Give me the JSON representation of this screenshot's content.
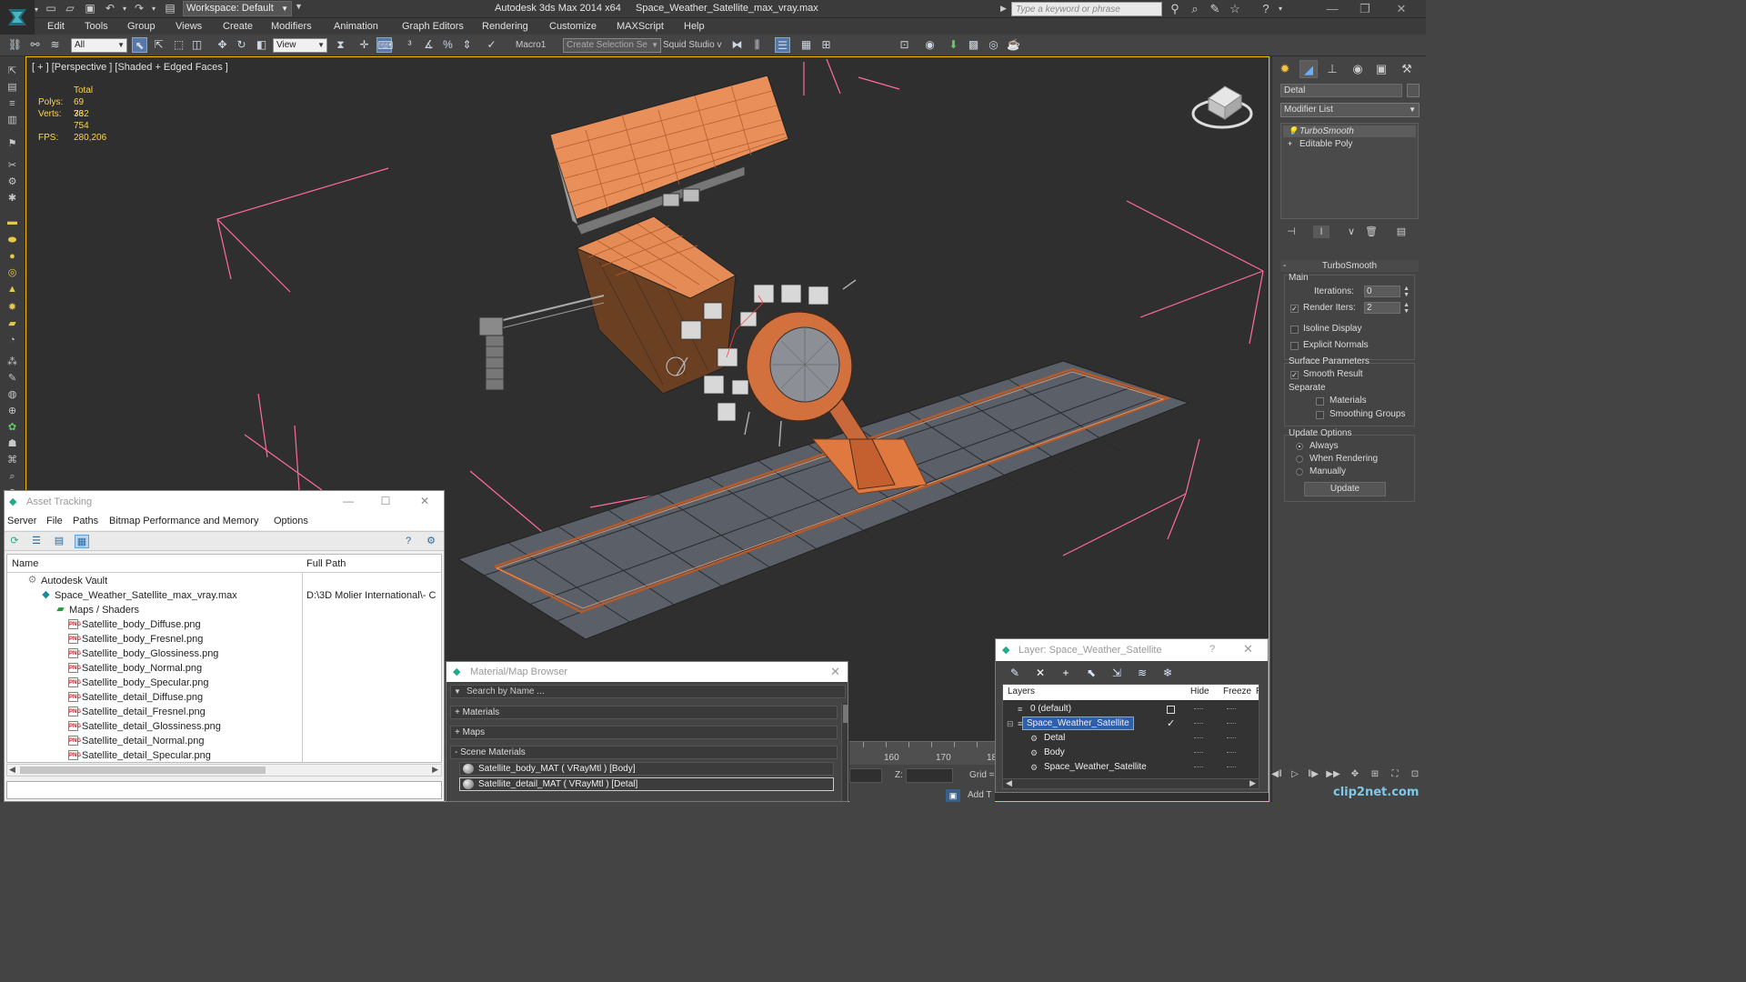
{
  "titlebar": {
    "workspace": "Workspace: Default",
    "app_title": "Autodesk 3ds Max  2014 x64",
    "file_name": "Space_Weather_Satellite_max_vray.max",
    "search_placeholder": "Type a keyword or phrase"
  },
  "menu": [
    "Edit",
    "Tools",
    "Group",
    "Views",
    "Create",
    "Modifiers",
    "Animation",
    "Graph Editors",
    "Rendering",
    "Customize",
    "MAXScript",
    "Help"
  ],
  "toolbar": {
    "selection_filter": "All",
    "ref_coord": "View",
    "macro_label": "Macro1",
    "selection_set": "Create Selection Se",
    "squid": "Squid Studio v"
  },
  "viewport": {
    "label": "[ + ] [Perspective ] [Shaded + Edged Faces ]",
    "stats": {
      "total_label": "Total",
      "polys_label": "Polys:",
      "polys": "69 732",
      "verts_label": "Verts:",
      "verts": "36 754",
      "fps_label": "FPS:",
      "fps": "280,206"
    }
  },
  "command_panel": {
    "object_name": "Detal",
    "modifier_list": "Modifier List",
    "stack": [
      "TurboSmooth",
      "Editable Poly"
    ],
    "rollout_title": "TurboSmooth",
    "main_label": "Main",
    "iterations_label": "Iterations:",
    "iterations": "0",
    "render_iters_label": "Render Iters:",
    "render_iters": "2",
    "render_iters_checked": true,
    "isoline_label": "Isoline Display",
    "explicit_normals_label": "Explicit Normals",
    "surface_params_label": "Surface Parameters",
    "smooth_result_label": "Smooth Result",
    "smooth_result_checked": true,
    "separate_label": "Separate",
    "materials_label": "Materials",
    "smoothing_groups_label": "Smoothing Groups",
    "update_options_label": "Update Options",
    "always_label": "Always",
    "when_rendering_label": "When Rendering",
    "manually_label": "Manually",
    "update_button": "Update"
  },
  "asset_tracking": {
    "title": "Asset Tracking",
    "menu": [
      "Server",
      "File",
      "Paths",
      "Bitmap Performance and Memory",
      "Options"
    ],
    "col_name": "Name",
    "col_path": "Full Path",
    "rows": [
      {
        "name": "Autodesk Vault",
        "path": "",
        "indent": 0,
        "icon": "vault"
      },
      {
        "name": "Space_Weather_Satellite_max_vray.max",
        "path": "D:\\3D Molier International\\- C",
        "indent": 1,
        "icon": "max"
      },
      {
        "name": "Maps / Shaders",
        "path": "",
        "indent": 2,
        "icon": "maps"
      },
      {
        "name": "Satellite_body_Diffuse.png",
        "path": "",
        "indent": 3,
        "icon": "png"
      },
      {
        "name": "Satellite_body_Fresnel.png",
        "path": "",
        "indent": 3,
        "icon": "png"
      },
      {
        "name": "Satellite_body_Glossiness.png",
        "path": "",
        "indent": 3,
        "icon": "png"
      },
      {
        "name": "Satellite_body_Normal.png",
        "path": "",
        "indent": 3,
        "icon": "png"
      },
      {
        "name": "Satellite_body_Specular.png",
        "path": "",
        "indent": 3,
        "icon": "png"
      },
      {
        "name": "Satellite_detail_Diffuse.png",
        "path": "",
        "indent": 3,
        "icon": "png"
      },
      {
        "name": "Satellite_detail_Fresnel.png",
        "path": "",
        "indent": 3,
        "icon": "png"
      },
      {
        "name": "Satellite_detail_Glossiness.png",
        "path": "",
        "indent": 3,
        "icon": "png"
      },
      {
        "name": "Satellite_detail_Normal.png",
        "path": "",
        "indent": 3,
        "icon": "png"
      },
      {
        "name": "Satellite_detail_Specular.png",
        "path": "",
        "indent": 3,
        "icon": "png"
      }
    ]
  },
  "material_browser": {
    "title": "Material/Map Browser",
    "search_placeholder": "Search by Name ...",
    "sections": [
      "+ Materials",
      "+ Maps",
      "- Scene Materials"
    ],
    "scene_materials": [
      "Satellite_body_MAT  ( VRayMtl )  [Body]",
      "Satellite_detail_MAT  ( VRayMtl )  [Detal]"
    ]
  },
  "timeline": {
    "ticks": [
      "160",
      "170",
      "18"
    ],
    "z_label": "Z:",
    "grid_label": "Grid =",
    "add_time": "Add T"
  },
  "layer_window": {
    "title": "Layer: Space_Weather_Satellite",
    "help": "?",
    "col_layers": "Layers",
    "col_hide": "Hide",
    "col_freeze": "Freeze",
    "col_r": "R",
    "rows": [
      {
        "name": "0 (default)",
        "indent": 1,
        "selected": false
      },
      {
        "name": "Space_Weather_Satellite",
        "indent": 1,
        "selected": true
      },
      {
        "name": "Detal",
        "indent": 2,
        "selected": false
      },
      {
        "name": "Body",
        "indent": 2,
        "selected": false
      },
      {
        "name": "Space_Weather_Satellite",
        "indent": 2,
        "selected": false
      }
    ]
  },
  "watermark": "clip2net.com",
  "colors": {
    "viewport_bg": "#2f2f2f",
    "active_border": "#ffc000",
    "stats_text": "#ffd54a",
    "satellite_orange": "#d9733d",
    "wire_pink": "#ff6aa0",
    "selection_blue": "#2d5fb0"
  }
}
